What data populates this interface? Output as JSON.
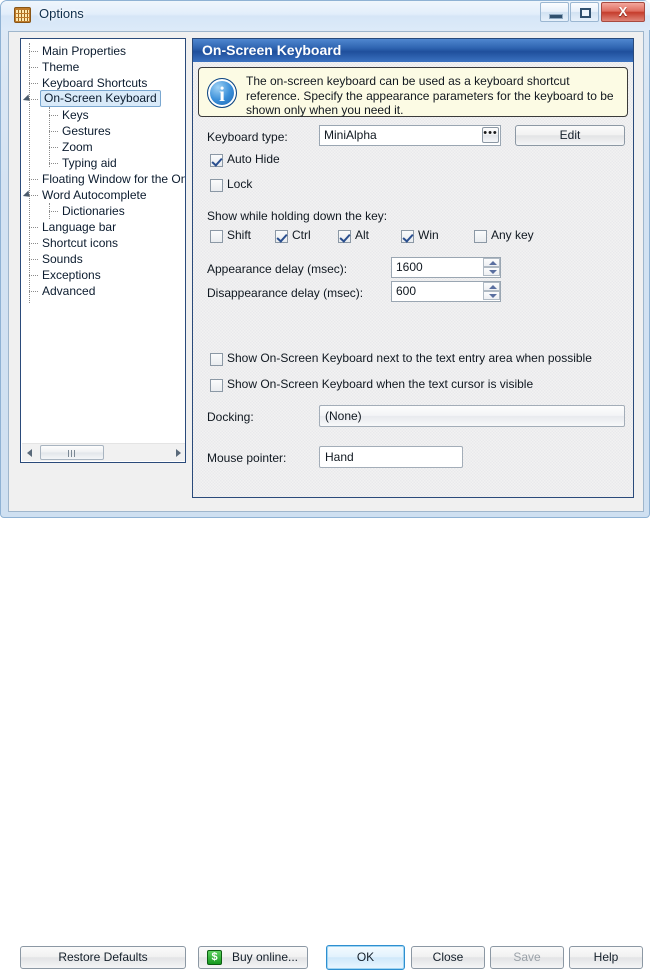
{
  "window": {
    "title": "Options",
    "icon": "keyboard-icon",
    "controls": {
      "minimize": "minimize-icon",
      "maximize": "maximize-icon",
      "close": "X"
    }
  },
  "sidebar": {
    "items": [
      {
        "label": "Main Properties",
        "level": 1,
        "selected": false,
        "expander": false
      },
      {
        "label": "Theme",
        "level": 1,
        "selected": false,
        "expander": false
      },
      {
        "label": "Keyboard Shortcuts",
        "level": 1,
        "selected": false,
        "expander": false
      },
      {
        "label": "On-Screen Keyboard",
        "level": 1,
        "selected": true,
        "expander": true
      },
      {
        "label": "Keys",
        "level": 2,
        "selected": false,
        "expander": false
      },
      {
        "label": "Gestures",
        "level": 2,
        "selected": false,
        "expander": false
      },
      {
        "label": "Zoom",
        "level": 2,
        "selected": false,
        "expander": false
      },
      {
        "label": "Typing aid",
        "level": 2,
        "selected": false,
        "expander": false
      },
      {
        "label": "Floating Window for the On-",
        "level": 1,
        "selected": false,
        "expander": false
      },
      {
        "label": "Word Autocomplete",
        "level": 1,
        "selected": false,
        "expander": true
      },
      {
        "label": "Dictionaries",
        "level": 2,
        "selected": false,
        "expander": false
      },
      {
        "label": "Language bar",
        "level": 1,
        "selected": false,
        "expander": false
      },
      {
        "label": "Shortcut icons",
        "level": 1,
        "selected": false,
        "expander": false
      },
      {
        "label": "Sounds",
        "level": 1,
        "selected": false,
        "expander": false
      },
      {
        "label": "Exceptions",
        "level": 1,
        "selected": false,
        "expander": false
      },
      {
        "label": "Advanced",
        "level": 1,
        "selected": false,
        "expander": false
      }
    ]
  },
  "content": {
    "header": "On-Screen Keyboard",
    "info": {
      "icon": "info-icon",
      "text": "The on-screen keyboard can be used as a keyboard shortcut reference. Specify the appearance parameters for the keyboard to be shown only when you need it."
    },
    "keyboard_type": {
      "label": "Keyboard type:",
      "value": "MiniAlpha",
      "browse_glyph": "•••",
      "edit_button": "Edit"
    },
    "auto_hide": {
      "label": "Auto Hide",
      "checked": true
    },
    "lock": {
      "label": "Lock",
      "checked": false
    },
    "hold_group": {
      "label": "Show while holding down the key:",
      "keys": [
        {
          "label": "Shift",
          "checked": false
        },
        {
          "label": "Ctrl",
          "checked": true
        },
        {
          "label": "Alt",
          "checked": true
        },
        {
          "label": "Win",
          "checked": true
        },
        {
          "label": "Any key",
          "checked": false
        }
      ]
    },
    "appearance_delay": {
      "label": "Appearance delay (msec):",
      "value": "1600"
    },
    "disappearance_delay": {
      "label": "Disappearance delay (msec):",
      "value": "600"
    },
    "show_next_to_text_entry": {
      "label": "Show On-Screen Keyboard next to the text entry area when possible",
      "checked": false
    },
    "show_when_cursor_visible": {
      "label": "Show On-Screen Keyboard when the text cursor is visible",
      "checked": false
    },
    "docking": {
      "label": "Docking:",
      "value": "(None)"
    },
    "mouse_pointer": {
      "label": "Mouse pointer:",
      "value": "Hand"
    }
  },
  "buttons": {
    "restore_defaults": "Restore Defaults",
    "buy_online": "Buy online...",
    "buy_online_icon": "$",
    "ok": "OK",
    "close": "Close",
    "save": "Save",
    "help": "Help"
  },
  "colors": {
    "header_blue": "#1f4f9c",
    "info_bg": "#fcfbe4",
    "tree_border": "#2a4a7a",
    "close_red": "#c53c2c",
    "default_btn_blue": "#2e8fd0"
  }
}
